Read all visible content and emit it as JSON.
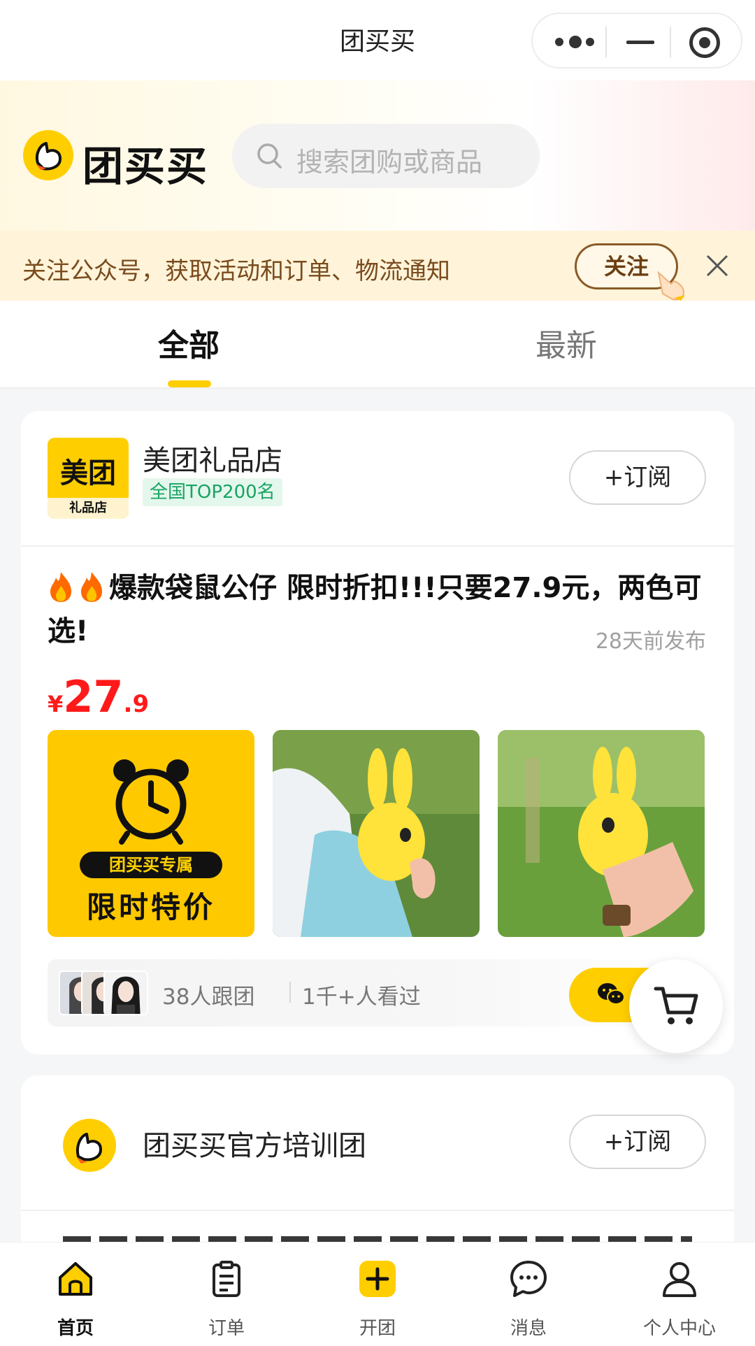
{
  "window": {
    "title": "团买买"
  },
  "brand": {
    "name": "团买买"
  },
  "search": {
    "placeholder": "搜索团购或商品"
  },
  "follow_bar": {
    "text": "关注公众号，获取活动和订单、物流通知",
    "button": "关注"
  },
  "tabs": [
    {
      "label": "全部",
      "active": true
    },
    {
      "label": "最新",
      "active": false
    }
  ],
  "cards": [
    {
      "shop": {
        "logo_main": "美团",
        "logo_sub": "礼品店",
        "name": "美团礼品店",
        "badge": "全国TOP200名"
      },
      "subscribe": "+订阅",
      "title": "爆款袋鼠公仔 限时折扣!!!只要27.9元，两色可选!",
      "time": "28天前发布",
      "price": {
        "currency": "¥",
        "int": "27",
        "dec": ".9"
      },
      "promo": {
        "tag1": "团买买专属",
        "tag2": "限时特价"
      },
      "stats": {
        "followers": "38人跟团",
        "views": "1千+人看过"
      }
    },
    {
      "shop": {
        "name": "团买买官方培训团"
      },
      "subscribe": "+订阅"
    }
  ],
  "nav": [
    {
      "label": "首页",
      "icon": "home-icon",
      "active": true
    },
    {
      "label": "订单",
      "icon": "order-icon",
      "active": false
    },
    {
      "label": "开团",
      "icon": "plus-icon",
      "active": false
    },
    {
      "label": "消息",
      "icon": "message-icon",
      "active": false
    },
    {
      "label": "个人中心",
      "icon": "user-icon",
      "active": false
    }
  ],
  "colors": {
    "accent": "#ffce00",
    "price": "#ff1a1a",
    "badge_text": "#19a463"
  }
}
